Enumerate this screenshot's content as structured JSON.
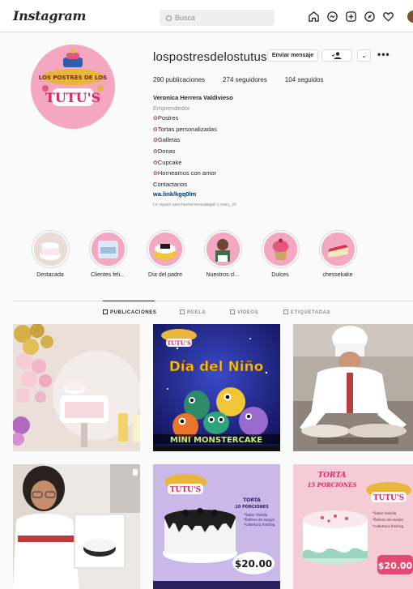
{
  "nav": {
    "logo": "Instagram",
    "search_placeholder": "Busca",
    "icons": [
      "home-icon",
      "messenger-icon",
      "new-post-icon",
      "explore-icon",
      "activity-heart-icon",
      "profile-avatar"
    ]
  },
  "profile": {
    "username": "lospostresdelostutus",
    "message_button": "Enviar mensaje",
    "follow_icon": "person-check-icon",
    "dropdown_icon": "chevron-down-icon",
    "more": "•••",
    "stats": {
      "posts": "290 publicaciones",
      "followers": "274 seguidores",
      "following": "104 seguidos"
    },
    "bio": {
      "name": "Veronica Herrera Valdivieso",
      "category": "Emprendedor",
      "lines": [
        "Postres",
        "Tortas personalizadas",
        "Galletas",
        "Donas",
        "Cupcake",
        "Horneamos con amor"
      ],
      "contact": "Contactanos",
      "link": "wa.link/kgq0lm"
    },
    "followed_by": "Le siguen sanchezherrerasabigail y mary_eli"
  },
  "highlights": [
    {
      "label": "Destacada"
    },
    {
      "label": "Clientes feli..."
    },
    {
      "label": "Día del padre"
    },
    {
      "label": "Nuestros cl..."
    },
    {
      "label": "Dulces"
    },
    {
      "label": "chessekake"
    }
  ],
  "tabs": [
    {
      "label": "PUBLICACIONES",
      "active": true
    },
    {
      "label": "REELS",
      "active": false
    },
    {
      "label": "VÍDEOS",
      "active": false
    },
    {
      "label": "ETIQUETADAS",
      "active": false
    }
  ],
  "posts": {
    "p2_title": "Día del Niño",
    "p2_subtitle": "MINI MONSTERCAKE",
    "p5_torta": "TORTA",
    "p5_porciones": "10 PORCIONES",
    "p5_features": [
      "*Sabor Vainilla",
      "*Relleno de manjar",
      "*cobertura frosting"
    ],
    "p5_price": "$20.00",
    "p6_torta": "TORTA",
    "p6_porciones": "15 PORCIONES",
    "p6_features": [
      "*Sabor Vainilla",
      "*Relleno de manjar",
      "*cobertura frosting"
    ],
    "p6_price": "$20.00",
    "logo_top": "LOS POSTRES DE LOS",
    "logo_bottom": "TUTU'S"
  }
}
